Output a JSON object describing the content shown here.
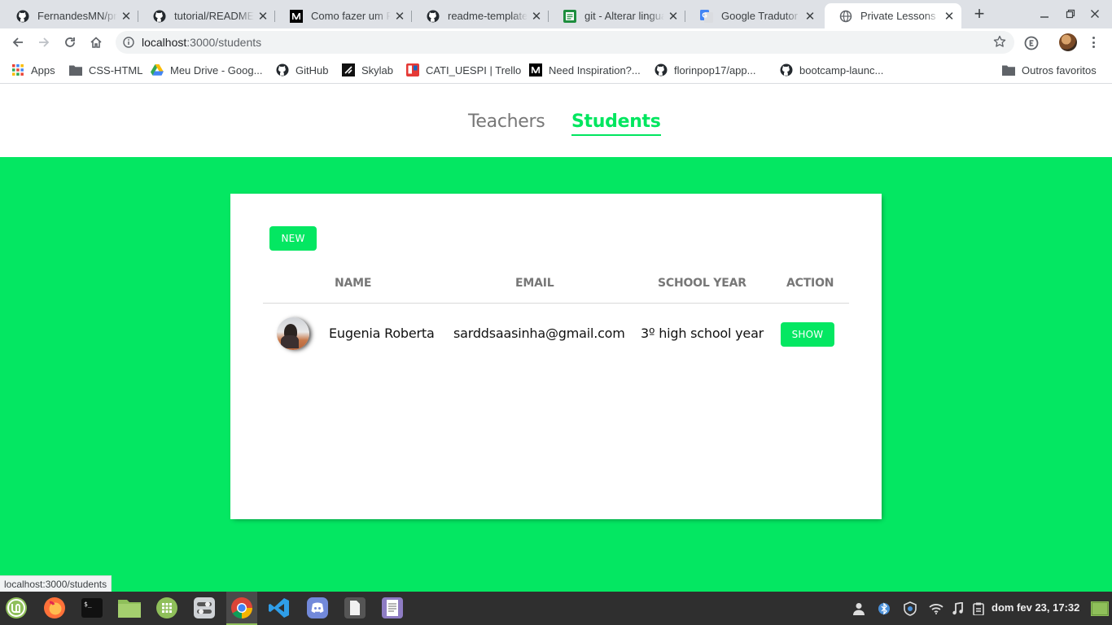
{
  "browser": {
    "tabs": [
      {
        "title": "FernandesMN/private-lessons",
        "icon": "github-icon"
      },
      {
        "title": "tutorial/README.md",
        "icon": "github-icon"
      },
      {
        "title": "Como fazer um README",
        "icon": "medium-icon"
      },
      {
        "title": "readme-template",
        "icon": "github-icon"
      },
      {
        "title": "git - Alterar lingua",
        "icon": "stackoverflow-icon"
      },
      {
        "title": "Google Tradutor",
        "icon": "google-translate-icon"
      },
      {
        "title": "Private Lessons",
        "icon": "globe-icon",
        "active": true
      }
    ],
    "new_tab_label": "+",
    "close_glyph": "✕",
    "address": {
      "host": "localhost",
      "path": ":3000/students"
    },
    "bookmarks": [
      {
        "label": "Apps",
        "icon": "apps-grid-icon"
      },
      {
        "label": "CSS-HTML",
        "icon": "folder-icon"
      },
      {
        "label": "Meu Drive - Goog...",
        "icon": "google-drive-icon"
      },
      {
        "label": "GitHub",
        "icon": "github-icon"
      },
      {
        "label": "Skylab",
        "icon": "skylab-icon"
      },
      {
        "label": "CATI_UESPI | Trello",
        "icon": "trello-icon"
      },
      {
        "label": "Need Inspiration?...",
        "icon": "medium-icon"
      },
      {
        "label": "florinpop17/app...",
        "icon": "github-icon"
      },
      {
        "label": "bootcamp-launc...",
        "icon": "github-icon"
      },
      {
        "label": "Outros favoritos",
        "icon": "folder-icon"
      }
    ],
    "status_url": "localhost:3000/students"
  },
  "page": {
    "nav": {
      "teachers": "Teachers",
      "students": "Students",
      "active": "students"
    },
    "new_button": "NEW",
    "columns": {
      "name": "NAME",
      "email": "EMAIL",
      "school_year": "SCHOOL YEAR",
      "action": "ACTION"
    },
    "students": [
      {
        "name": "Eugenia Roberta",
        "email": "sarddsaasinha@gmail.com",
        "school_year": "3º high school year",
        "action": "SHOW"
      }
    ],
    "accent_color": "#04e762"
  },
  "taskbar": {
    "apps": [
      "mint-menu-icon",
      "firefox-icon",
      "terminal-icon",
      "files-icon",
      "spreadsheet-icon",
      "settings-icon",
      "chrome-icon",
      "vscode-icon",
      "discord-icon",
      "document-viewer-icon",
      "text-editor-icon"
    ],
    "clock": "dom fev 23, 17:32"
  }
}
